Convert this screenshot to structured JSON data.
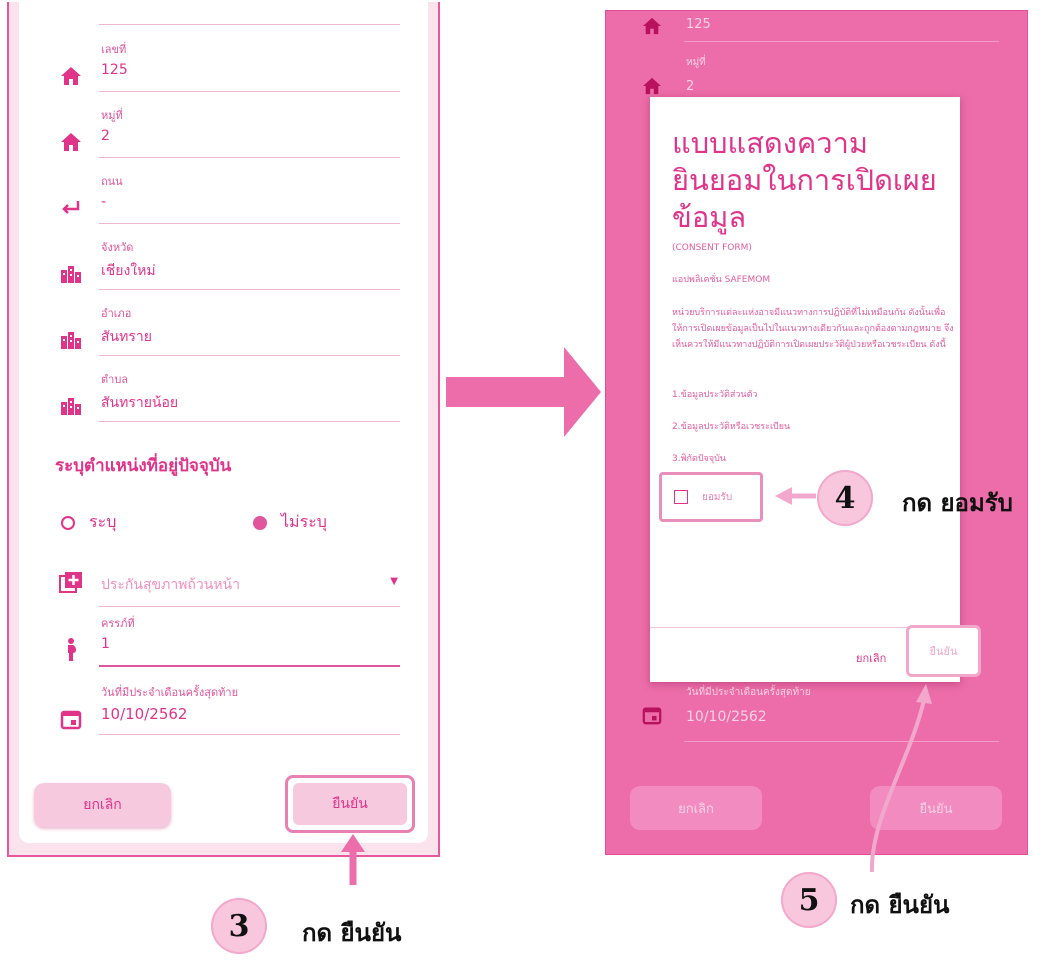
{
  "left": {
    "fields": [
      {
        "icon": "home-icon",
        "label": "เลขที่",
        "value": "125"
      },
      {
        "icon": "home-icon",
        "label": "หมู่ที่",
        "value": "2"
      },
      {
        "icon": "return-icon",
        "label": "ถนน",
        "value": "-"
      },
      {
        "icon": "city-icon",
        "label": "จังหวัด",
        "value": "เชียงใหม่"
      },
      {
        "icon": "city-icon",
        "label": "อำเภอ",
        "value": "สันทราย"
      },
      {
        "icon": "city-icon",
        "label": "ตำบล",
        "value": "สันทรายน้อย"
      }
    ],
    "location_title": "ระบุตำแหน่งที่อยู่ปัจจุบัน",
    "radio_specify": "ระบุ",
    "radio_not_specify": "ไม่ระบุ",
    "insurance": "ประกันสุขภาพถ้วนหน้า",
    "pregnancy_label": "ครรภ์ที่",
    "pregnancy_value": "1",
    "last_period_label": "วันที่มีประจำเดือนครั้งสุดท้าย",
    "last_period_value": "10/10/2562",
    "cancel": "ยกเลิก",
    "confirm": "ยืนยัน"
  },
  "right": {
    "bg_house_no": "125",
    "bg_moo_label": "หมู่ที่",
    "bg_moo_value": "2",
    "bg_period_label": "วันที่มีประจำเดือนครั้งสุดท้าย",
    "bg_period_value": "10/10/2562",
    "cancel": "ยกเลิก",
    "confirm": "ยืนยัน",
    "dialog": {
      "title": "แบบแสดงความยินยอมในการเปิดเผยข้อมูล",
      "subtitle": "(CONSENT FORM)",
      "app": "แอปพลิเคชั่น SAFEMOM",
      "body": "หน่วยบริการแต่ละแห่งอาจมีแนวทางการปฏิบัติที่ไม่เหมือนกัน ดังนั้นเพื่อให้การเปิดเผยข้อมูลเป็นไปในแนวทางเดียวกันและถูกต้องตามกฎหมาย จึงเห็นควรให้มีแนวทางปฏิบัติการเปิดเผยประวัติผู้ป่วยหรือเวชระเบียน ดังนี้",
      "item1": "1.ข้อมูลประวัติส่วนตัว",
      "item2": "2.ข้อมูลประวัติหรือเวชระเบียน",
      "item3": "3.พิกัดปัจจุบัน",
      "accept": "ยอมรับ",
      "cancel": "ยกเลิก",
      "confirm": "ยืนยัน"
    }
  },
  "callouts": {
    "step3_num": "3",
    "step3_text": "กด ยืนยัน",
    "step4_num": "4",
    "step4_text": "กด ยอมรับ",
    "step5_num": "5",
    "step5_text": "กด ยืนยัน"
  },
  "colors": {
    "accent": "#e0338a",
    "highlight": "#e980b3",
    "overlay": "#ec6da9"
  }
}
